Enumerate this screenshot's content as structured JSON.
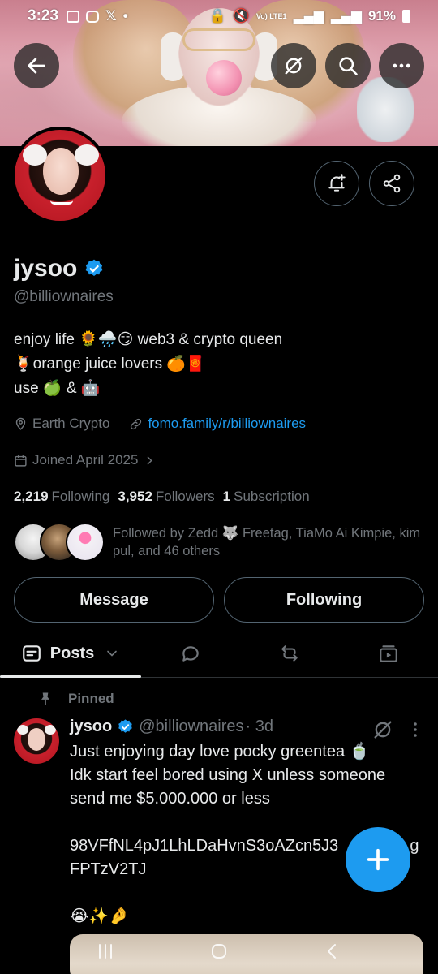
{
  "status_bar": {
    "time": "3:23",
    "notification_icons": [
      "gallery-icon",
      "instagram-icon",
      "x-icon",
      "dot-icon"
    ],
    "network_label": "Vo) LTE1",
    "battery": "91%"
  },
  "header": {
    "back": "back-arrow-icon",
    "grok": "grok-icon",
    "search": "search-icon",
    "more": "more-icon"
  },
  "profile": {
    "display_name": "jysoo",
    "handle": "@billiownaires",
    "bio_lines": [
      "enjoy life 🌻🌧️😏 web3 & crypto queen",
      "🍹orange juice lovers 🍊🧧",
      "use 🍏 & 🤖"
    ],
    "location": "Earth Crypto",
    "website": "fomo.family/r/billiownaires",
    "joined": "Joined April 2025",
    "following_count": "2,219",
    "following_label": "Following",
    "followers_count": "3,952",
    "followers_label": "Followers",
    "subscription_count": "1",
    "subscription_label": "Subscription",
    "followed_by_text": "Followed by Zedd 🐺 Freetag, TiaMo Ai Kimpie, kim pul, and 46 others",
    "message_label": "Message",
    "following_button_label": "Following"
  },
  "tabs": {
    "posts_label": "Posts"
  },
  "pinned_tweet": {
    "pinned_label": "Pinned",
    "author_name": "jysoo",
    "author_handle": "@billiownaires",
    "time": "· 3d",
    "text_lines": [
      "Just enjoying day love pocky greentea 🍵",
      "Idk start feel bored using X unless someone",
      "send me $5.000.000 or less",
      "",
      "98VFfNL4pJ1LhLDaHvnS3oAZcn5J3",
      "FPTzV2TJ",
      "",
      "😭✨🤌"
    ],
    "text_line_tail": "g"
  },
  "colors": {
    "accent": "#1d9bf0",
    "background": "#000000",
    "text_primary": "#e7e9ea",
    "text_secondary": "#71767b",
    "border": "#536471"
  }
}
